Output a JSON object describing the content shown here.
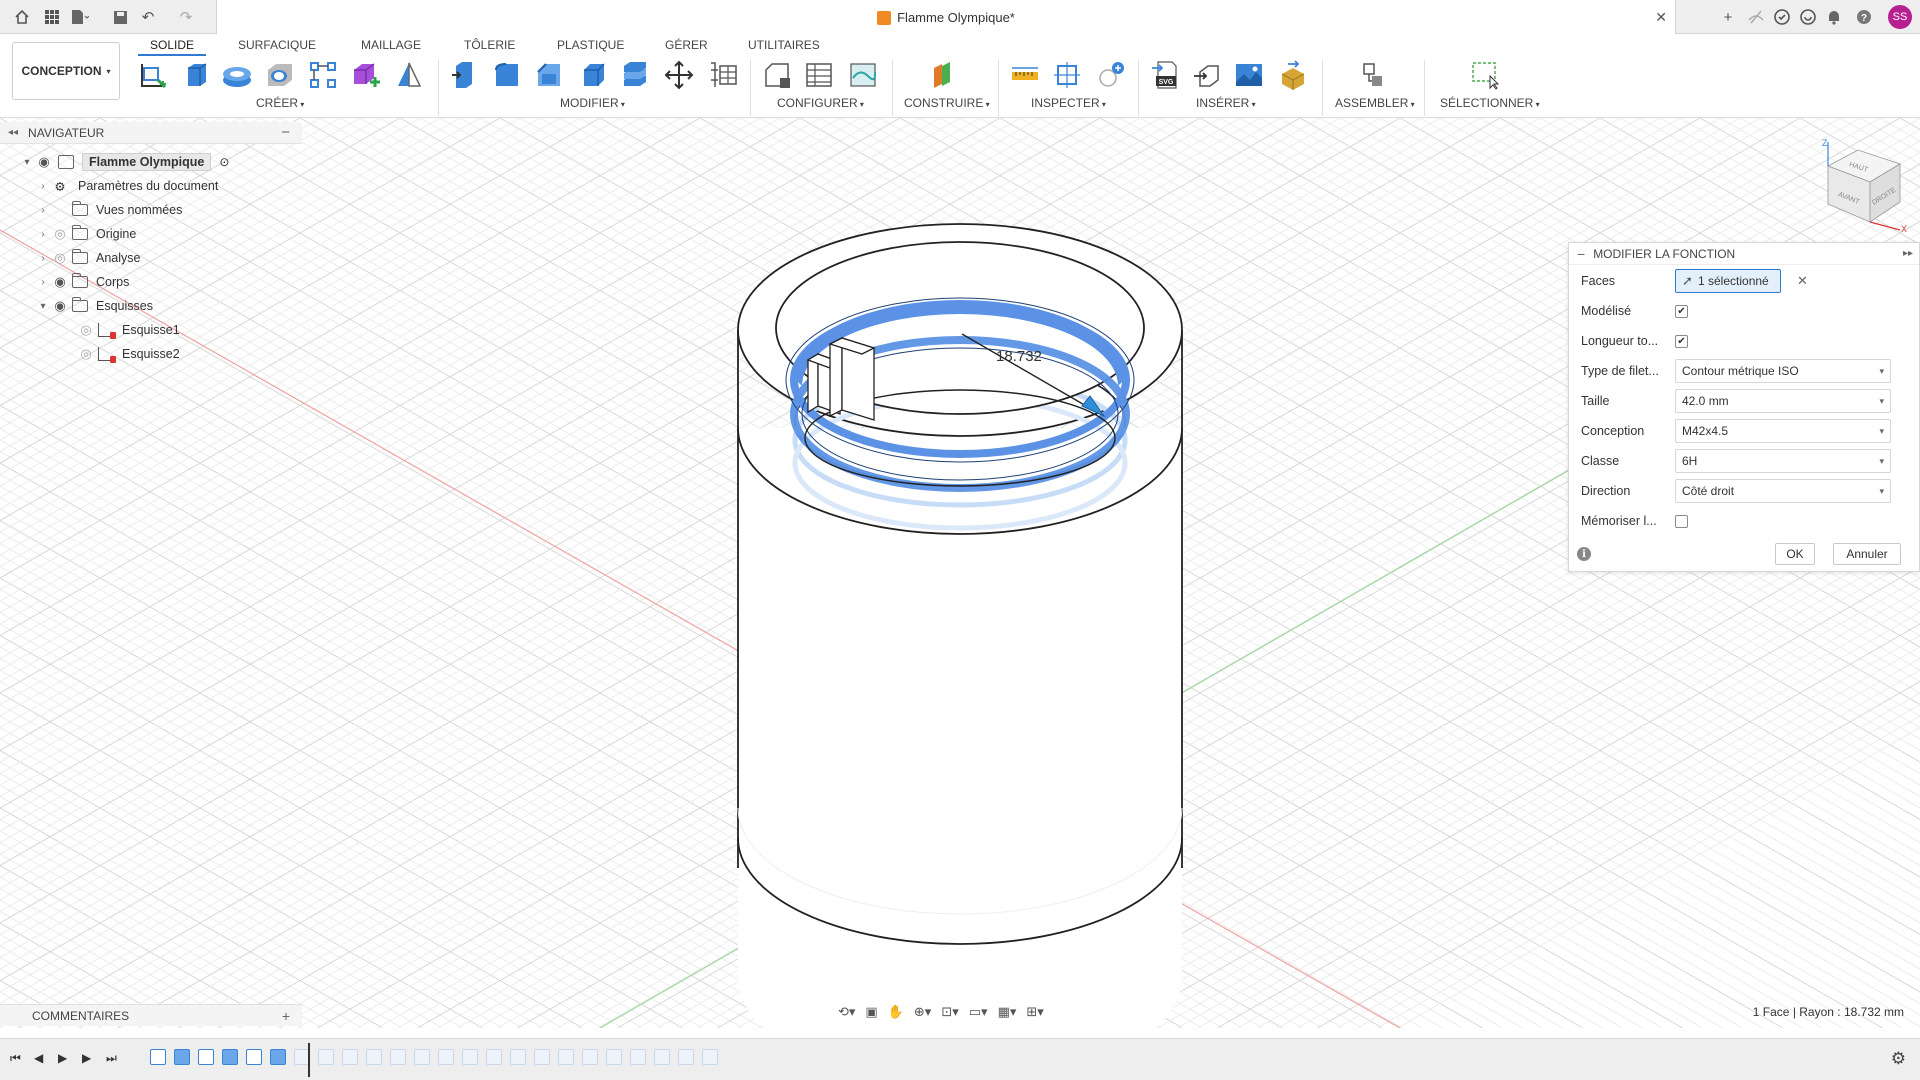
{
  "document": {
    "title": "Flamme Olympique*"
  },
  "user": {
    "initials": "SS"
  },
  "toolbar": {
    "workspace": "CONCEPTION",
    "tabs": [
      "SOLIDE",
      "SURFACIQUE",
      "MAILLAGE",
      "TÔLERIE",
      "PLASTIQUE",
      "GÉRER",
      "UTILITAIRES"
    ],
    "groups": [
      "CRÉER",
      "MODIFIER",
      "CONFIGURER",
      "CONSTRUIRE",
      "INSPECTER",
      "INSÉRER",
      "ASSEMBLER",
      "SÉLECTIONNER"
    ]
  },
  "navigator": {
    "title": "NAVIGATEUR",
    "root": "Flamme Olympique",
    "items": [
      {
        "label": "Paramètres du document",
        "icon": "gear-icon"
      },
      {
        "label": "Vues nommées",
        "icon": "folder-icon"
      },
      {
        "label": "Origine",
        "icon": "folder-icon"
      },
      {
        "label": "Analyse",
        "icon": "folder-icon"
      },
      {
        "label": "Corps",
        "icon": "folder-icon"
      },
      {
        "label": "Esquisses",
        "icon": "folder-icon"
      },
      {
        "label": "Esquisse1",
        "icon": "sketch-icon"
      },
      {
        "label": "Esquisse2",
        "icon": "sketch-icon"
      }
    ]
  },
  "comments": {
    "title": "COMMENTAIRES"
  },
  "viewport": {
    "dimension_label": "18.732"
  },
  "viewcube": {
    "top": "HAUT",
    "front": "AVANT",
    "right": "DROITE",
    "axis_z": "Z",
    "axis_x": "X"
  },
  "dialog": {
    "title": "MODIFIER LA FONCTION",
    "faces_label": "Faces",
    "faces_value": "1 sélectionné",
    "modelise_label": "Modélisé",
    "modelise_checked": true,
    "longueur_label": "Longueur to...",
    "longueur_checked": true,
    "type_label": "Type de filet...",
    "type_value": "Contour métrique ISO",
    "taille_label": "Taille",
    "taille_value": "42.0 mm",
    "conception_label": "Conception",
    "conception_value": "M42x4.5",
    "classe_label": "Classe",
    "classe_value": "6H",
    "direction_label": "Direction",
    "direction_value": "Côté droit",
    "memoriser_label": "Mémoriser l...",
    "memoriser_checked": false,
    "ok_label": "OK",
    "cancel_label": "Annuler"
  },
  "status": {
    "text": "1 Face | Rayon : 18.732 mm"
  },
  "colors": {
    "accent": "#2f7bd4",
    "selection": "#5b92e5",
    "avatar": "#b6218f"
  }
}
